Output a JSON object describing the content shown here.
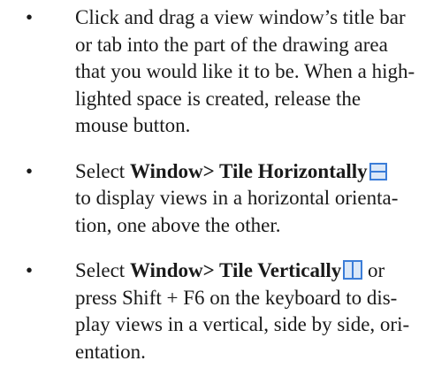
{
  "bullets": [
    {
      "lines": [
        "Click and drag a view window’s title bar",
        "or tab into the part of the drawing area",
        "that you would like it to be. When a high-",
        "lighted space is created, release the",
        "mouse button."
      ]
    },
    {
      "line1": {
        "prefix": "Select ",
        "bold": "Window> Tile Horizontally",
        "icon": "tile-horizontally-icon"
      },
      "rest": [
        "to display views in a horizontal orienta-",
        "tion, one above the other."
      ]
    },
    {
      "line1": {
        "prefix": "Select ",
        "bold": "Window> Tile Vertically",
        "icon": "tile-vertically-icon",
        "suffix": " or"
      },
      "rest": [
        "press Shift + F6 on the keyboard to dis-",
        "play views in a vertical, side by side, ori-",
        "entation."
      ]
    }
  ],
  "colors": {
    "icon_stroke": "#3b7dd8",
    "icon_fill": "#dbe8f8"
  }
}
